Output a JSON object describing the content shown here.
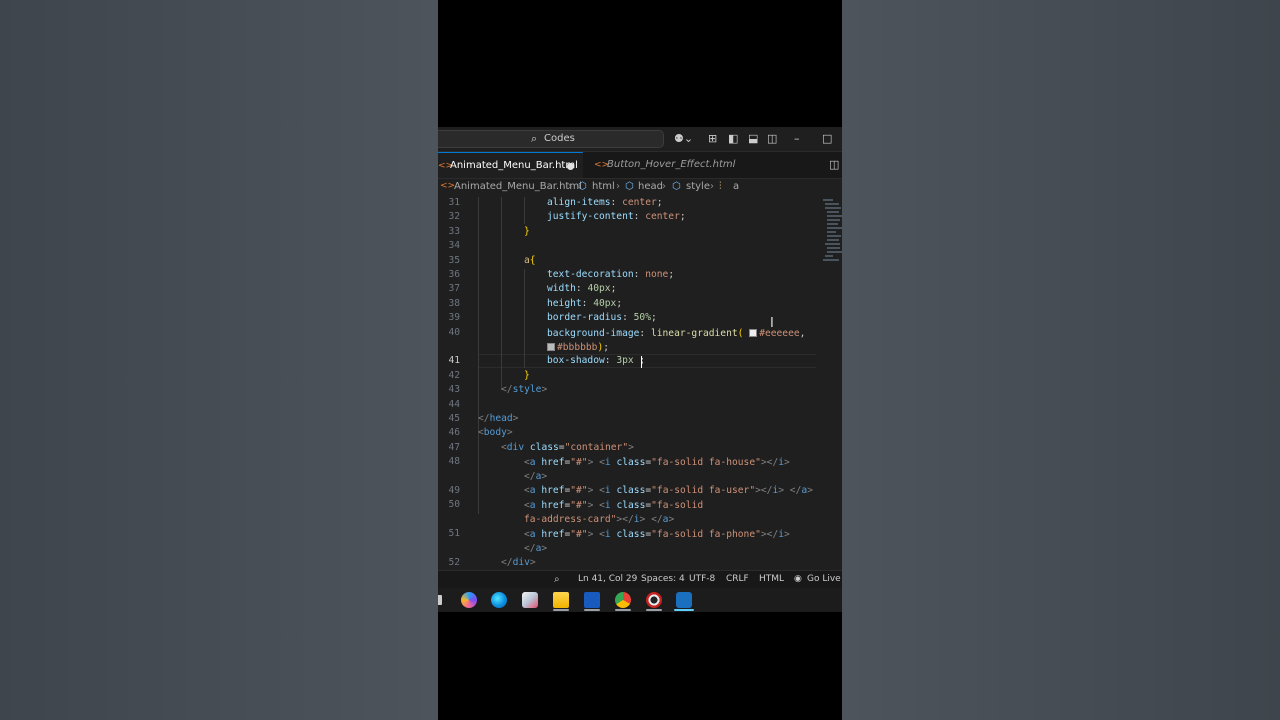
{
  "window": {
    "search_text": "Codes"
  },
  "tabs": [
    {
      "label": "Animated_Menu_Bar.html",
      "icon": "html-file-icon",
      "active": true,
      "dirty": true
    },
    {
      "label": "Button_Hover_Effect.html",
      "icon": "html-file-icon",
      "active": false,
      "dirty": false
    }
  ],
  "breadcrumb": {
    "file": "Animated_Menu_Bar.html",
    "html": "html",
    "head": "head",
    "style": "style",
    "a": "a"
  },
  "editor": {
    "current_line": 41,
    "lines": [
      {
        "num": "31",
        "text": "align-items: center;"
      },
      {
        "num": "32",
        "text": "justify-content: center;"
      },
      {
        "num": "33",
        "text": "}"
      },
      {
        "num": "34",
        "text": ""
      },
      {
        "num": "35",
        "text": "a{"
      },
      {
        "num": "36",
        "text": "text-decoration: none;"
      },
      {
        "num": "37",
        "text": "width: 40px;"
      },
      {
        "num": "38",
        "text": "height: 40px;"
      },
      {
        "num": "39",
        "text": "border-radius: 50%;"
      },
      {
        "num": "40",
        "text": "background-image: linear-gradient( #eeeeee, #bbbbbb);"
      },
      {
        "num": "41",
        "text": "box-shadow: 3px ;"
      },
      {
        "num": "42",
        "text": "}"
      },
      {
        "num": "43",
        "text": "</style>"
      },
      {
        "num": "44",
        "text": ""
      },
      {
        "num": "45",
        "text": "</head>"
      },
      {
        "num": "46",
        "text": "<body>"
      },
      {
        "num": "47",
        "text": "<div class=\"container\">"
      },
      {
        "num": "48",
        "text": "<a href=\"#\"> <i class=\"fa-solid fa-house\"></i> </a>"
      },
      {
        "num": "49",
        "text": "<a href=\"#\"> <i class=\"fa-solid fa-user\"></i> </a>"
      },
      {
        "num": "50",
        "text": "<a href=\"#\"> <i class=\"fa-solid fa-address-card\"></i> </a>"
      },
      {
        "num": "51",
        "text": "<a href=\"#\"> <i class=\"fa-solid fa-phone\"></i> </a>"
      },
      {
        "num": "52",
        "text": "</div>"
      }
    ],
    "swatch_colors": [
      "#eeeeee",
      "#bbbbbb"
    ]
  },
  "statusbar": {
    "position": "Ln 41, Col 29",
    "spaces": "Spaces: 4",
    "encoding": "UTF-8",
    "eol": "CRLF",
    "language": "HTML",
    "golive": "Go Live"
  },
  "taskbar": {
    "apps": [
      "copilot-icon",
      "edge-icon",
      "paint-icon",
      "file-explorer-icon",
      "word-icon",
      "chrome-icon",
      "chrome-canary-icon",
      "vscode-icon"
    ]
  },
  "colors": {
    "accent": "#0078d4",
    "editor_bg": "#1f1f1f",
    "property": "#9cdcfe",
    "value": "#ce9178",
    "number": "#b5cea8",
    "tag": "#569cd6",
    "bracket": "#ffd700"
  }
}
